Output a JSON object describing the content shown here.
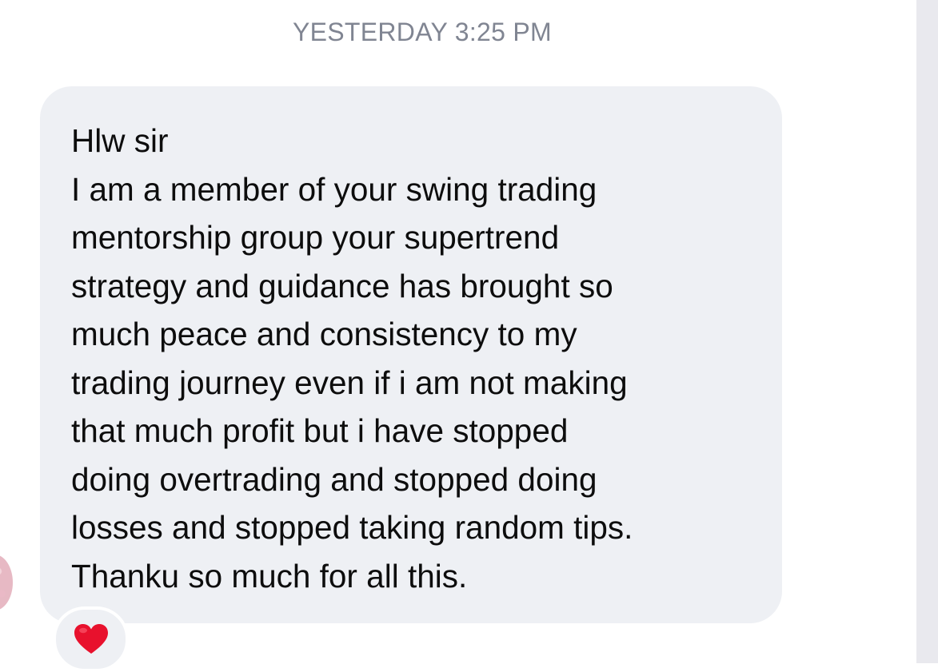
{
  "timestamp": "YESTERDAY 3:25 PM",
  "message": {
    "lines": [
      "Hlw sir",
      "I am a member of your swing trading",
      "mentorship group your supertrend",
      "strategy and guidance has brought so",
      "much peace and consistency to my",
      "trading journey even if i am not making",
      "that much profit but i have stopped",
      "doing overtrading and stopped doing",
      "losses and stopped taking random tips.",
      "Thanku so much for all this."
    ]
  },
  "reaction": {
    "icon": "red-heart-icon",
    "color": "#e8112d"
  },
  "colors": {
    "bubble": "#eef0f4",
    "timestamp_text": "#808592",
    "message_text": "#0d0d0d"
  }
}
